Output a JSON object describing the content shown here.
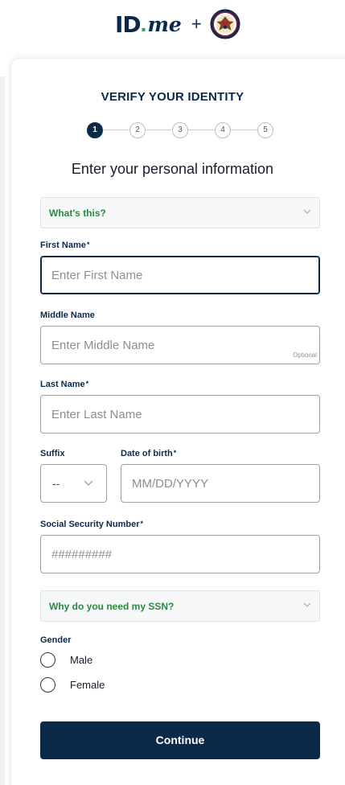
{
  "header": {
    "logo_id": "ID",
    "logo_me": "me",
    "plus": "+",
    "partner_seal": "va-seal-icon"
  },
  "verify": {
    "title": "VERIFY YOUR IDENTITY",
    "steps": [
      "1",
      "2",
      "3",
      "4",
      "5"
    ],
    "current_step": 1,
    "subtitle": "Enter your personal information"
  },
  "whats_this": {
    "label": "What's this?"
  },
  "form": {
    "first_name": {
      "label": "First Name",
      "required_mark": "*",
      "placeholder": "Enter First Name",
      "value": ""
    },
    "middle_name": {
      "label": "Middle Name",
      "placeholder": "Enter Middle Name",
      "optional_tag": "Optional",
      "value": ""
    },
    "last_name": {
      "label": "Last Name",
      "required_mark": "*",
      "placeholder": "Enter Last Name",
      "value": ""
    },
    "suffix": {
      "label": "Suffix",
      "selected": "--"
    },
    "dob": {
      "label": "Date of birth",
      "required_mark": "*",
      "placeholder": "MM/DD/YYYY",
      "value": ""
    },
    "ssn": {
      "label": "Social Security Number",
      "required_mark": "*",
      "placeholder": "#########",
      "value": ""
    },
    "why_ssn": {
      "label": "Why do you need my SSN?"
    },
    "gender": {
      "label": "Gender",
      "options": [
        "Male",
        "Female"
      ]
    }
  },
  "continue_label": "Continue",
  "colors": {
    "brand_navy": "#0b2a4a",
    "accent_green": "#2a8a3e",
    "border_gray": "#9aa0a8"
  }
}
